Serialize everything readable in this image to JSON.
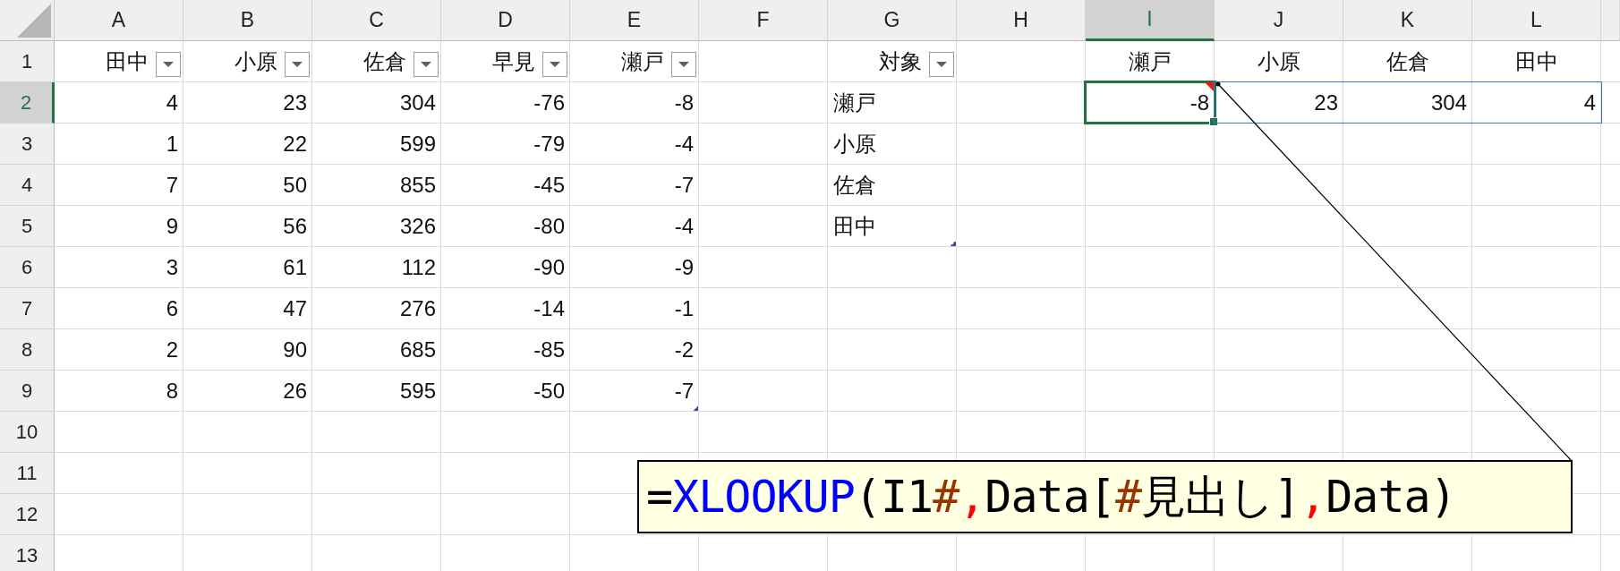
{
  "columns": [
    {
      "label": "A",
      "selected": false
    },
    {
      "label": "B",
      "selected": false
    },
    {
      "label": "C",
      "selected": false
    },
    {
      "label": "D",
      "selected": false
    },
    {
      "label": "E",
      "selected": false
    },
    {
      "label": "F",
      "selected": false
    },
    {
      "label": "G",
      "selected": false
    },
    {
      "label": "H",
      "selected": false
    },
    {
      "label": "I",
      "selected": true
    },
    {
      "label": "J",
      "selected": false
    },
    {
      "label": "K",
      "selected": false
    },
    {
      "label": "L",
      "selected": false
    }
  ],
  "rows": [
    {
      "label": "1",
      "selected": false,
      "cells": {
        "A": {
          "kind": "filter-header",
          "text": "田中"
        },
        "B": {
          "kind": "filter-header",
          "text": "小原"
        },
        "C": {
          "kind": "filter-header",
          "text": "佐倉"
        },
        "D": {
          "kind": "filter-header",
          "text": "早見"
        },
        "E": {
          "kind": "filter-header",
          "text": "瀬戸"
        },
        "G": {
          "kind": "filter-header",
          "text": "対象"
        },
        "I": {
          "kind": "heading",
          "text": "瀬戸"
        },
        "J": {
          "kind": "heading",
          "text": "小原"
        },
        "K": {
          "kind": "heading",
          "text": "佐倉"
        },
        "L": {
          "kind": "heading",
          "text": "田中"
        }
      }
    },
    {
      "label": "2",
      "selected": true,
      "cells": {
        "A": {
          "kind": "number",
          "text": "4"
        },
        "B": {
          "kind": "number",
          "text": "23"
        },
        "C": {
          "kind": "number",
          "text": "304"
        },
        "D": {
          "kind": "number",
          "text": "-76"
        },
        "E": {
          "kind": "number",
          "text": "-8"
        },
        "G": {
          "kind": "text",
          "text": "瀬戸"
        },
        "I": {
          "kind": "number",
          "text": "-8",
          "active": true,
          "flagged": true
        },
        "J": {
          "kind": "number",
          "text": "23",
          "spill": true
        },
        "K": {
          "kind": "number",
          "text": "304",
          "spill": true
        },
        "L": {
          "kind": "number",
          "text": "4",
          "spill": true
        }
      }
    },
    {
      "label": "3",
      "selected": false,
      "cells": {
        "A": {
          "kind": "number",
          "text": "1"
        },
        "B": {
          "kind": "number",
          "text": "22"
        },
        "C": {
          "kind": "number",
          "text": "599"
        },
        "D": {
          "kind": "number",
          "text": "-79"
        },
        "E": {
          "kind": "number",
          "text": "-4"
        },
        "G": {
          "kind": "text",
          "text": "小原"
        }
      }
    },
    {
      "label": "4",
      "selected": false,
      "cells": {
        "A": {
          "kind": "number",
          "text": "7"
        },
        "B": {
          "kind": "number",
          "text": "50"
        },
        "C": {
          "kind": "number",
          "text": "855"
        },
        "D": {
          "kind": "number",
          "text": "-45"
        },
        "E": {
          "kind": "number",
          "text": "-7"
        },
        "G": {
          "kind": "text",
          "text": "佐倉"
        }
      }
    },
    {
      "label": "5",
      "selected": false,
      "cells": {
        "A": {
          "kind": "number",
          "text": "9"
        },
        "B": {
          "kind": "number",
          "text": "56"
        },
        "C": {
          "kind": "number",
          "text": "326"
        },
        "D": {
          "kind": "number",
          "text": "-80"
        },
        "E": {
          "kind": "number",
          "text": "-4"
        },
        "G": {
          "kind": "text",
          "text": "田中",
          "table_end": true
        }
      }
    },
    {
      "label": "6",
      "selected": false,
      "cells": {
        "A": {
          "kind": "number",
          "text": "3"
        },
        "B": {
          "kind": "number",
          "text": "61"
        },
        "C": {
          "kind": "number",
          "text": "112"
        },
        "D": {
          "kind": "number",
          "text": "-90"
        },
        "E": {
          "kind": "number",
          "text": "-9"
        }
      }
    },
    {
      "label": "7",
      "selected": false,
      "cells": {
        "A": {
          "kind": "number",
          "text": "6"
        },
        "B": {
          "kind": "number",
          "text": "47"
        },
        "C": {
          "kind": "number",
          "text": "276"
        },
        "D": {
          "kind": "number",
          "text": "-14"
        },
        "E": {
          "kind": "number",
          "text": "-1"
        }
      }
    },
    {
      "label": "8",
      "selected": false,
      "cells": {
        "A": {
          "kind": "number",
          "text": "2"
        },
        "B": {
          "kind": "number",
          "text": "90"
        },
        "C": {
          "kind": "number",
          "text": "685"
        },
        "D": {
          "kind": "number",
          "text": "-85"
        },
        "E": {
          "kind": "number",
          "text": "-2"
        }
      }
    },
    {
      "label": "9",
      "selected": false,
      "cells": {
        "A": {
          "kind": "number",
          "text": "8"
        },
        "B": {
          "kind": "number",
          "text": "26"
        },
        "C": {
          "kind": "number",
          "text": "595"
        },
        "D": {
          "kind": "number",
          "text": "-50"
        },
        "E": {
          "kind": "number",
          "text": "-7",
          "table_end": true
        }
      }
    },
    {
      "label": "10",
      "selected": false,
      "cells": {}
    },
    {
      "label": "11",
      "selected": false,
      "cells": {}
    },
    {
      "label": "12",
      "selected": false,
      "cells": {}
    },
    {
      "label": "13",
      "selected": false,
      "cells": {}
    }
  ],
  "formula_callout": {
    "segments": [
      {
        "text": "=",
        "color": "#000000"
      },
      {
        "text": "XLOOKUP",
        "color": "#0000ff"
      },
      {
        "text": "(I1",
        "color": "#000000"
      },
      {
        "text": "#",
        "color": "#993300"
      },
      {
        "text": ",",
        "color": "#ff0000"
      },
      {
        "text": "Data[",
        "color": "#000000"
      },
      {
        "text": "#",
        "color": "#993300"
      },
      {
        "text": "見出し]",
        "color": "#000000"
      },
      {
        "text": ",",
        "color": "#ff0000"
      },
      {
        "text": "Data)",
        "color": "#000000"
      }
    ]
  }
}
